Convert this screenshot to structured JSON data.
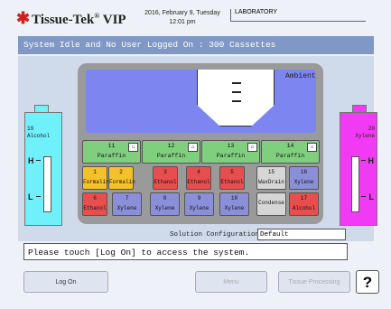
{
  "header": {
    "logo": "Tissue-Tek",
    "logo_suffix": "VIP",
    "logo_mark": "®",
    "date_line": "2016, February 9, Tuesday",
    "time_line": "12:01 pm",
    "location": "LABORATORY"
  },
  "status": "System Idle and No User Logged On  : 300 Cassettes",
  "retort_label": "Ambient",
  "left_bottle": {
    "num": "19",
    "name": "Alcohol",
    "high": "H",
    "low": "L"
  },
  "right_bottle": {
    "num": "20",
    "name": "Xylene",
    "high": "H",
    "low": "L"
  },
  "paraffin": [
    {
      "num": "11",
      "name": "Paraffin"
    },
    {
      "num": "12",
      "name": "Paraffin"
    },
    {
      "num": "13",
      "name": "Paraffin"
    },
    {
      "num": "14",
      "name": "Paraffin"
    }
  ],
  "reagents_top": [
    {
      "num": "1",
      "name": "Formalin",
      "color": "#f5c12a"
    },
    {
      "num": "2",
      "name": "Formalin",
      "color": "#f5c12a"
    },
    {
      "num": "3",
      "name": "Ethanol",
      "color": "#e84e4e"
    },
    {
      "num": "4",
      "name": "Ethanol",
      "color": "#e84e4e"
    },
    {
      "num": "5",
      "name": "Ethanol",
      "color": "#e84e4e"
    },
    {
      "num": "15",
      "name": "WaxDrain",
      "color": "#d6d6d6"
    },
    {
      "num": "16",
      "name": "Xylene",
      "color": "#8a8fd8"
    }
  ],
  "reagents_bottom": [
    {
      "num": "6",
      "name": "Ethanol",
      "color": "#e84e4e"
    },
    {
      "num": "7",
      "name": "Xylene",
      "color": "#8a8fd8"
    },
    {
      "num": "8",
      "name": "Xylene",
      "color": "#8a8fd8"
    },
    {
      "num": "9",
      "name": "Xylene",
      "color": "#8a8fd8"
    },
    {
      "num": "10",
      "name": "Xylene",
      "color": "#8a8fd8"
    },
    {
      "num": "",
      "name": "Condense",
      "color": "#d6d6d6"
    },
    {
      "num": "17",
      "name": "Alcohol",
      "color": "#e84e4e"
    }
  ],
  "solution_config": {
    "label": "Solution Configuration",
    "value": "Default"
  },
  "message": "Please touch [Log On] to access the system.",
  "buttons": {
    "logon": "Log On",
    "menu": "Menu",
    "tissue": "Tissue Processing",
    "help": "?"
  }
}
